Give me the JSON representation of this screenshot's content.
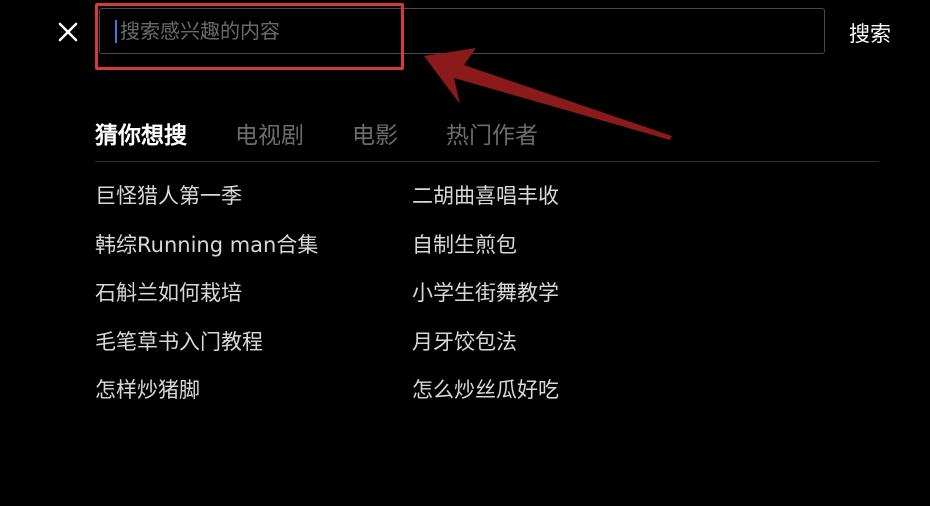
{
  "header": {
    "close_icon": "close-icon",
    "search_placeholder": "搜索感兴趣的内容",
    "search_value": "",
    "search_button_label": "搜索"
  },
  "tabs": [
    {
      "label": "猜你想搜",
      "active": true
    },
    {
      "label": "电视剧",
      "active": false
    },
    {
      "label": "电影",
      "active": false
    },
    {
      "label": "热门作者",
      "active": false
    }
  ],
  "suggestions": {
    "left": [
      "巨怪猎人第一季",
      "韩综Running man合集",
      "石斛兰如何栽培",
      "毛笔草书入门教程",
      "怎样炒猪脚"
    ],
    "right": [
      "二胡曲喜唱丰收",
      "自制生煎包",
      "小学生街舞教学",
      "月牙饺包法",
      "怎么炒丝瓜好吃"
    ]
  },
  "annotations": {
    "highlight_color": "#d63a3a",
    "arrow_color": "#8b1a1a"
  },
  "colors": {
    "background": "#000000",
    "caret": "#3d7bd9",
    "tab_inactive": "#6c6c6c",
    "text": "#d8d8d8"
  }
}
